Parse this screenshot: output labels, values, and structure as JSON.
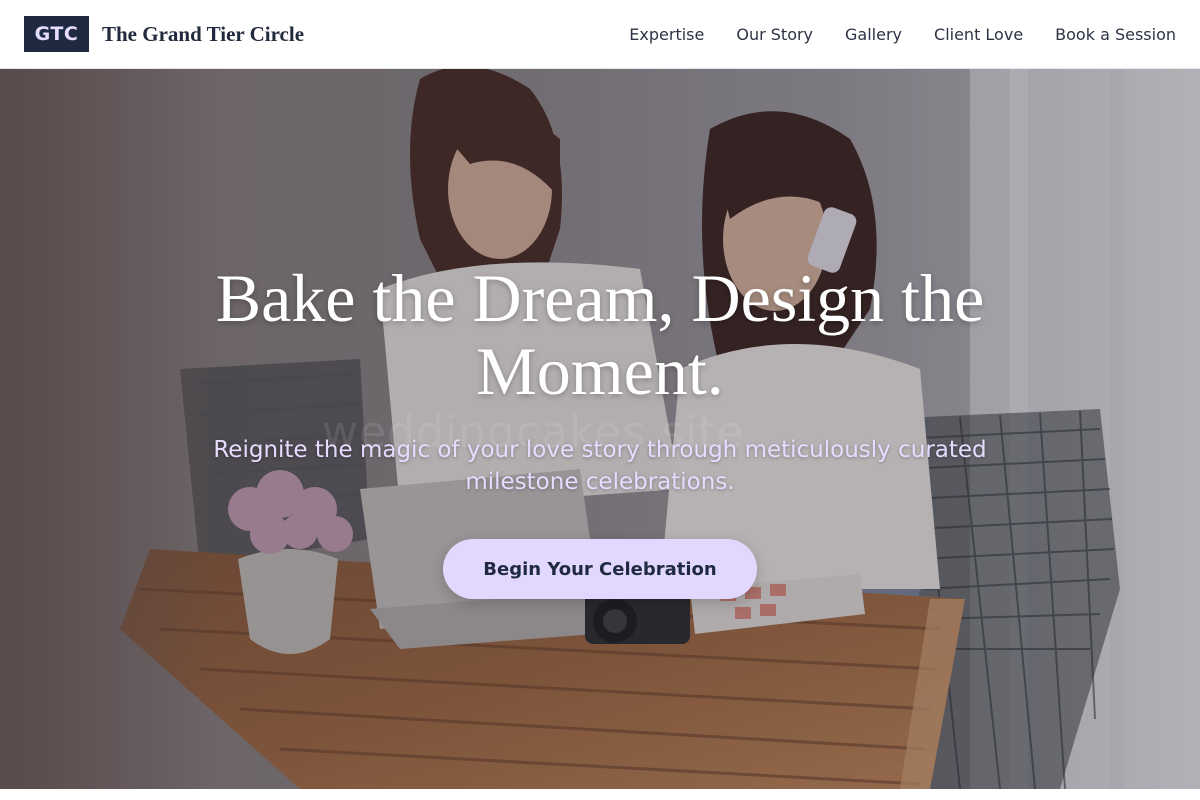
{
  "header": {
    "logo_text": "GTC",
    "brand_name": "The Grand Tier Circle",
    "nav": [
      {
        "label": "Expertise"
      },
      {
        "label": "Our Story"
      },
      {
        "label": "Gallery"
      },
      {
        "label": "Client Love"
      },
      {
        "label": "Book a Session"
      }
    ]
  },
  "hero": {
    "title": "Bake the Dream, Design the Moment.",
    "subtitle": "Reignite the magic of your love story through meticulously curated milestone celebrations.",
    "cta_label": "Begin Your Celebration",
    "watermark": "weddingcakes.site",
    "image_subject": "two women at a wooden table with laptop, camera, notebook and flowers"
  },
  "colors": {
    "logo_bg": "#1f2a40",
    "logo_text": "#e6dcff",
    "accent_lavender": "#e2d8ff",
    "nav_text": "#2d3345",
    "hero_title": "#ffffff"
  }
}
